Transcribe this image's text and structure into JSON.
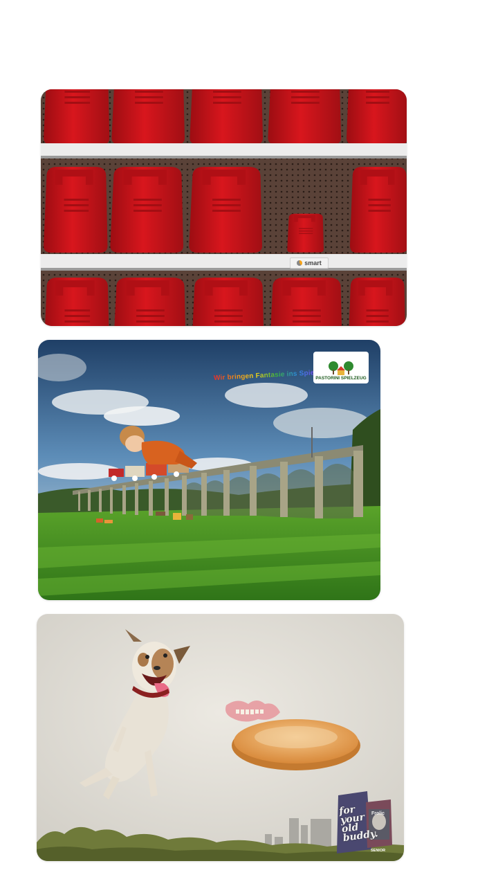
{
  "feed": {
    "cards": [
      {
        "id": "smart-ad",
        "brand_label": "smart"
      },
      {
        "id": "pastorini-ad",
        "headline": "Wir bringen Fantasie ins Spiel.",
        "brand_label": "PASTORINI SPIELZEUG"
      },
      {
        "id": "frolic-ad",
        "pack_title": "for your old buddy.",
        "pack_brand": "Frolic",
        "pack_variant": "SENIOR"
      }
    ]
  },
  "colors": {
    "canister_red": "#c8141b",
    "shelf_white": "#e9e9e9",
    "pegboard_brown": "#5a4238",
    "sky_blue": "#4a7aa6",
    "grass_green": "#3f8a1e",
    "dog_bg": "#dedbd4"
  }
}
